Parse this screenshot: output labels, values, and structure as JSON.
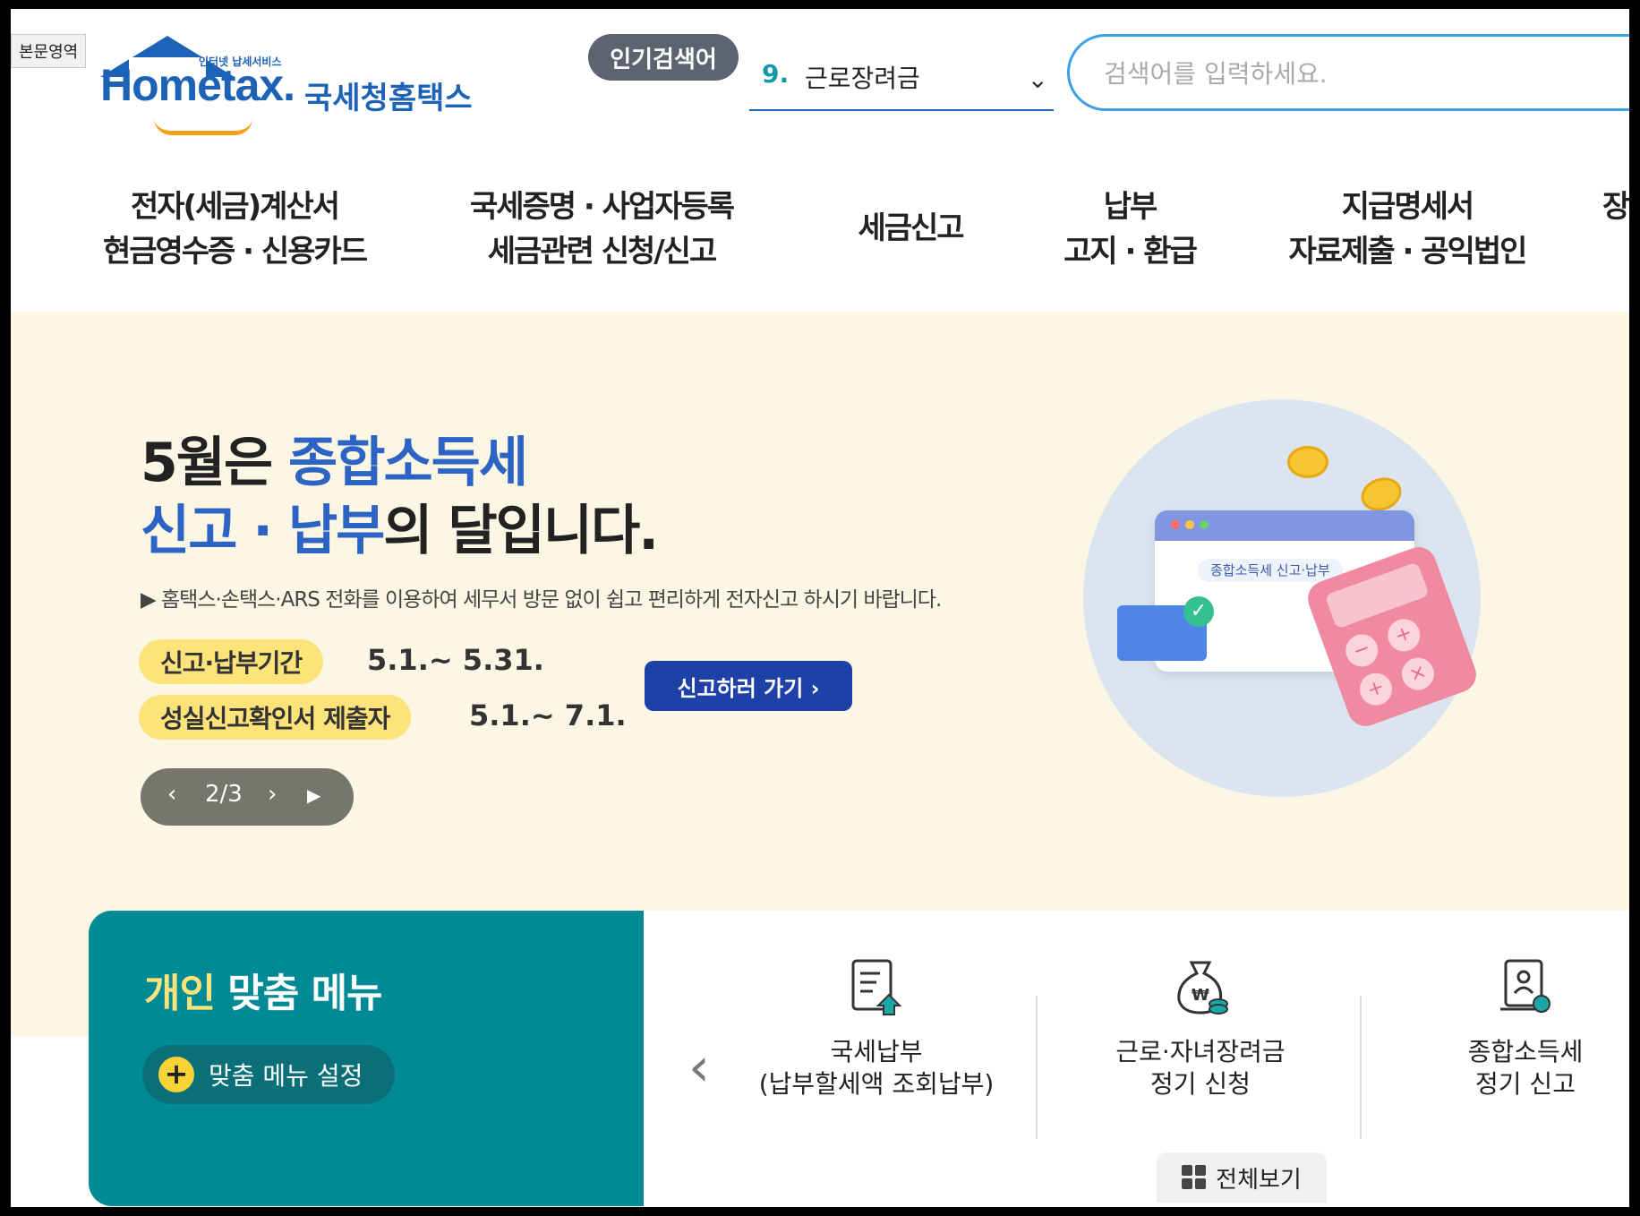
{
  "skip_link": "본문영역",
  "logo": {
    "tagline": "인터넷 납세서비스",
    "brand": "Hometax.",
    "korean_name": "국세청홈택스"
  },
  "popular": {
    "badge": "인기검색어",
    "rank": "9.",
    "keyword": "근로장려금"
  },
  "search": {
    "placeholder": "검색어를 입력하세요."
  },
  "nav": {
    "items": [
      {
        "line1": "전자(세금)계산서",
        "line2": "현금영수증 · 신용카드"
      },
      {
        "line1": "국세증명 · 사업자등록",
        "line2": "세금관련 신청/신고"
      },
      {
        "line1": "세금신고",
        "line2": ""
      },
      {
        "line1": "납부",
        "line2": "고지 · 환급"
      },
      {
        "line1": "지급명세서",
        "line2": "자료제출 · 공익법인"
      },
      {
        "line1": "장",
        "line2": ""
      }
    ]
  },
  "hero": {
    "title_a": "5월은 ",
    "title_b": "종합소득세",
    "title_c": "신고 · 납부",
    "title_d": "의 달입니다.",
    "description": "▶ 홈택스·손택스·ARS 전화를 이용하여 세무서 방문 없이 쉽고 편리하게 전자신고 하시기 바랍니다.",
    "period1_label": "신고·납부기간",
    "period1_date": "5.1.~ 5.31.",
    "period2_label": "성실신고확인서 제출자",
    "period2_date": "5.1.~ 7.1.",
    "cta": "신고하러 가기 ›",
    "illustration_label": "종합소득세 신고·납부",
    "pager": {
      "current": "2/3",
      "prev": "‹",
      "next": "›",
      "play": "▶"
    }
  },
  "personal_menu": {
    "title_highlight": "개인",
    "title_rest": " 맞춤 메뉴",
    "setup_button": "맞춤 메뉴 설정"
  },
  "quick_menu": {
    "prev": "‹",
    "items": [
      {
        "line1": "국세납부",
        "line2": "(납부할세액 조회납부)",
        "icon": "tax-payment-icon"
      },
      {
        "line1": "근로·자녀장려금",
        "line2": "정기 신청",
        "icon": "money-bag-icon"
      },
      {
        "line1": "종합소득세",
        "line2": "정기 신고",
        "icon": "income-tax-report-icon"
      }
    ],
    "view_all": "전체보기"
  },
  "colors": {
    "brand_blue": "#1c63b7",
    "accent_teal": "#008a95",
    "hero_bg": "#fbf7e4",
    "pill_yellow": "#fde37a",
    "cta_blue": "#1e41a8"
  }
}
